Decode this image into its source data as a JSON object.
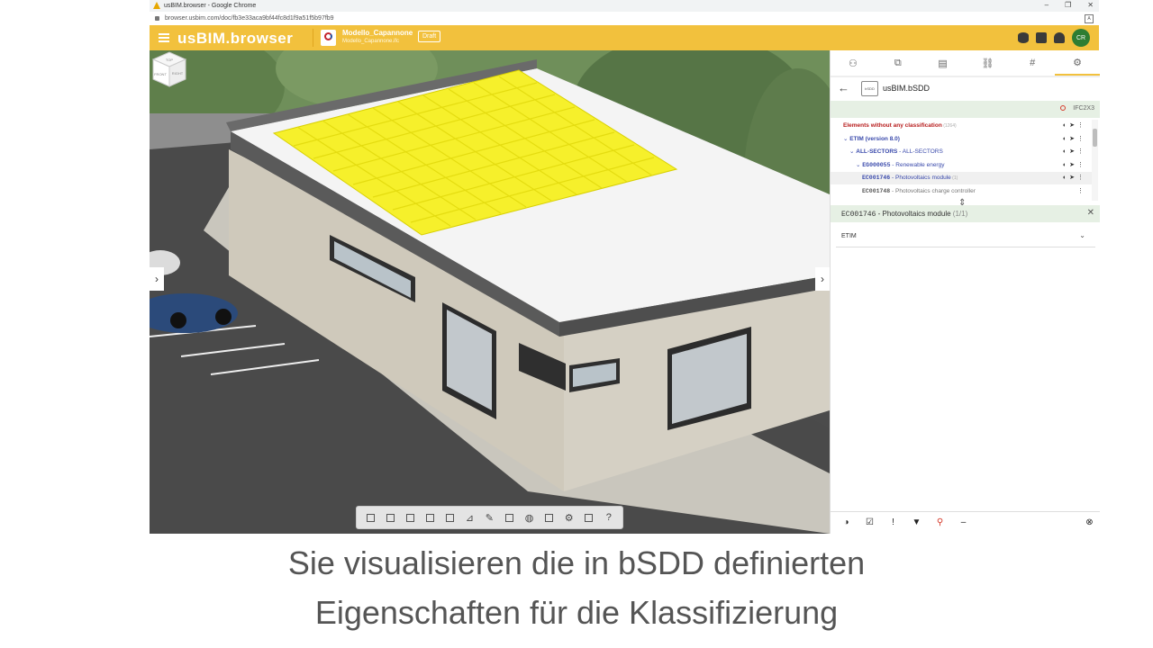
{
  "browser": {
    "window_title": "usBIM.browser - Google Chrome",
    "url": "browser.usbim.com/doc/fb3e33aca9bf44fc8d1f9a51f5b97fb9",
    "controls": [
      "–",
      "❐",
      "✕"
    ]
  },
  "header": {
    "logo_us": "us",
    "logo_bim": "BIM",
    "logo_browser": ".browser",
    "model_name": "Modello_Capannone",
    "model_sub": "Modello_Capannone.ifc",
    "status": "Draft",
    "avatar": "CR",
    "icons": [
      "database-icon",
      "layers-icon",
      "bell-icon"
    ]
  },
  "viewer": {
    "cube_top": "TOP",
    "cube_front": "FRONT",
    "cube_right": "RIGHT",
    "toolbar_icons": [
      "camera",
      "cube",
      "layers",
      "box",
      "section",
      "measure",
      "pen",
      "edit",
      "globe",
      "clone",
      "gear",
      "fit",
      "help"
    ]
  },
  "panel": {
    "tabs": [
      "people-icon",
      "copy-icon",
      "document-icon",
      "link-icon",
      "hash-icon",
      "classification-icon"
    ],
    "title": "usBIM.bSDD",
    "logo_text": "bSDD",
    "ifc_version": "IFC2X3",
    "tree": [
      {
        "code": "Elements without any classification",
        "sep": "",
        "label": "",
        "count": "(1264)",
        "level": 0,
        "color": "#b71c1c",
        "selected": false
      },
      {
        "code": "ETIM (version 8.0)",
        "sep": "",
        "label": "",
        "count": "",
        "level": 0,
        "color": "#3949ab",
        "selected": false,
        "chev": "⌄"
      },
      {
        "code": "ALL-SECTORS",
        "sep": " - ",
        "label": "ALL-SECTORS",
        "count": "",
        "level": 1,
        "color": "#3949ab",
        "selected": false,
        "chev": "⌄"
      },
      {
        "code": "EG000055",
        "sep": " - ",
        "label": "Renewable energy",
        "count": "",
        "level": 2,
        "color": "#3949ab",
        "selected": false,
        "chev": "⌄"
      },
      {
        "code": "EC001746",
        "sep": " - ",
        "label": "Photovoltaics module",
        "count": "(1)",
        "level": 3,
        "color": "#3949ab",
        "selected": true
      },
      {
        "code": "EC001748",
        "sep": " - ",
        "label": "Photovoltaics charge controller",
        "count": "",
        "level": 3,
        "color": "#555",
        "selected": false
      }
    ],
    "section_code": "EC001746",
    "section_label": "Photovoltaics module",
    "section_count": "(1/1)",
    "etim_label": "ETIM",
    "footer_icons": [
      "contrast-icon",
      "checklist-icon",
      "alert-icon",
      "filter-icon",
      "search-icon",
      "minus-icon",
      "settings-circle-icon"
    ]
  },
  "caption": {
    "line1": "Sie visualisieren die in bSDD definierten",
    "line2": "Eigenschaften für die Klassifizierung"
  },
  "colors": {
    "accent": "#f2c13d",
    "panel_green": "#e6f0e4",
    "avatar": "#2e7d32",
    "solar": "#f6f02b"
  }
}
